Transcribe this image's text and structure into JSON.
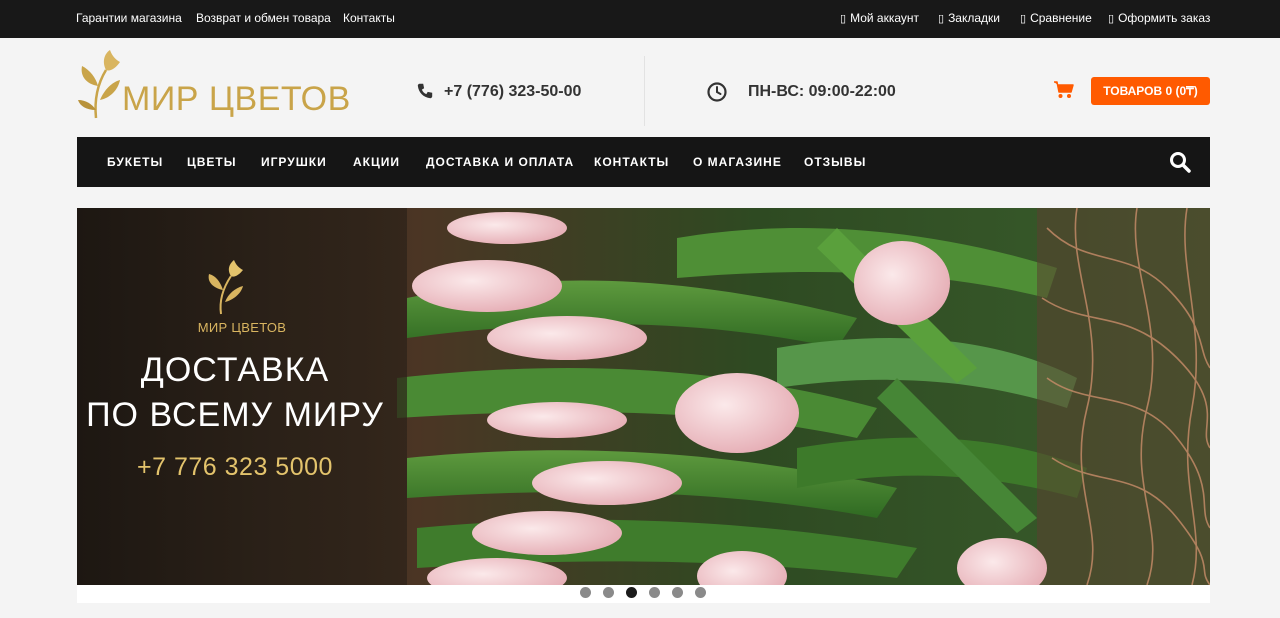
{
  "topbar": {
    "left_links": [
      "Гарантии магазина",
      "Возврат и обмен товара",
      "Контакты"
    ],
    "right_links": [
      "Мой аккаунт",
      "Закладки",
      "Сравнение",
      "Оформить заказ"
    ]
  },
  "header": {
    "logo_text": "МИР ЦВЕТОВ",
    "phone": "+7 (776) 323-50-00",
    "hours": "ПН-ВС: 09:00-22:00",
    "cart_label": "ТОВАРОВ 0 (0₸)"
  },
  "nav": {
    "items": [
      "БУКЕТЫ",
      "ЦВЕТЫ",
      "ИГРУШКИ",
      "АКЦИИ",
      "ДОСТАВКА И ОПЛАТА",
      "КОНТАКТЫ",
      "О МАГАЗИНЕ",
      "ОТЗЫВЫ"
    ]
  },
  "slider": {
    "brand": "МИР ЦВЕТОВ",
    "line1": "ДОСТАВКА",
    "line2": "ПО ВСЕМУ МИРУ",
    "phone": "+7 776 323 5000",
    "slide_count": 6,
    "active_slide": 3
  },
  "colors": {
    "topbar_bg": "#181818",
    "accent_orange": "#ff5a00",
    "gold": "#c9a449",
    "nav_bg": "#151515"
  },
  "icons": {
    "phone": "phone-icon",
    "clock": "clock-icon",
    "cart": "cart-icon",
    "search": "search-icon",
    "topbar_square": "square-icon"
  }
}
